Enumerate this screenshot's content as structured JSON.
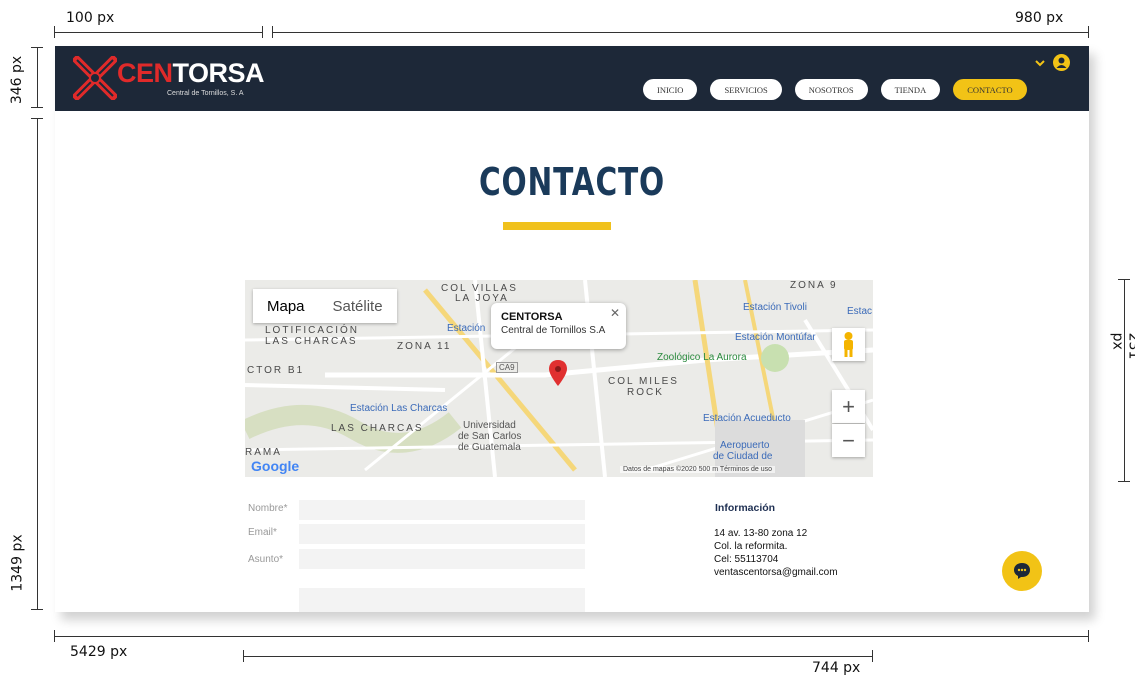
{
  "annotations": {
    "top_left": "100  px",
    "top_right": "980  px",
    "left_header": "346 px",
    "left_page": "1349 px",
    "right_side": "231 px",
    "bottom_full": "5429  px",
    "bottom_map": "744  px"
  },
  "header": {
    "logo_red": "CEN",
    "logo_white": "TORSA",
    "logo_sub": "Central de Tornillos, S. A",
    "nav": [
      "INICIO",
      "SERVICIOS",
      "NOSOTROS",
      "TIENDA",
      "CONTACTO"
    ],
    "active_nav": "CONTACTO",
    "user_icon": "user-circle-icon"
  },
  "main": {
    "title": "CONTACTO",
    "accent_color": "#f0c11c"
  },
  "map": {
    "toggle_map": "Mapa",
    "toggle_sat": "Satélite",
    "info_title": "CENTORSA",
    "info_sub": "Central de Tornillos S.A",
    "labels": {
      "col_villas": "COL VILLAS",
      "la_joya": "LA JOYA",
      "lotificacion": "LOTIFICACIÓN",
      "las_charcas_top": "LAS CHARCAS",
      "zona11": "ZONA 11",
      "ctor_b1": "CTOR B1",
      "estacion": "Estación",
      "est_tivoli": "Estación Tivoli",
      "estac": "Estac",
      "est_montufar": "Estación Montúfar",
      "zoologico": "Zoológico La Aurora",
      "col_miles": "COL MILES",
      "rock": "ROCK",
      "est_charcas": "Estación Las Charcas",
      "las_charcas": "LAS CHARCAS",
      "usac1": "Universidad",
      "usac2": "de San Carlos",
      "usac3": "de Guatemala",
      "est_acueducto": "Estación Acueducto",
      "aeropuerto1": "Aeropuerto",
      "aeropuerto2": "de Ciudad de",
      "rama": "RAMA",
      "zona9": "ZONA 9",
      "ca9": "CA9"
    },
    "google": "Google",
    "footer": "Datos de mapas ©2020    500 m               Términos de uso",
    "zoom_in": "+",
    "zoom_out": "−"
  },
  "form": {
    "nombre": "Nombre*",
    "email": "Email*",
    "asunto": "Asunto*"
  },
  "info": {
    "title": "Información",
    "lines": [
      "14 av. 13-80 zona 12",
      "Col. la reformita.",
      "Cel: 55113704",
      "ventascentorsa@gmail.com"
    ]
  }
}
